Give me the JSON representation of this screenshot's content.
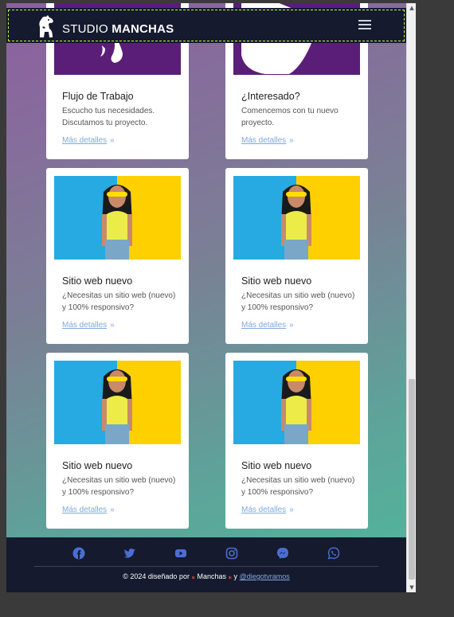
{
  "header": {
    "brand_light": "STUDIO",
    "brand_bold": "MANCHAS"
  },
  "cards": [
    {
      "title": "Flujo de Trabajo",
      "desc": "Escucho tus necesidades. Discutamos tu proyecto.",
      "more": "Más detalles"
    },
    {
      "title": "¿Interesado?",
      "desc": "Comencemos con tu nuevo proyecto.",
      "more": "Más detalles"
    },
    {
      "title": "Sitio web nuevo",
      "desc": "¿Necesitas un sitio web (nuevo) y 100% responsivo?",
      "more": "Más detalles"
    },
    {
      "title": "Sitio web nuevo",
      "desc": "¿Necesitas un sitio web (nuevo) y 100% responsivo?",
      "more": "Más detalles"
    },
    {
      "title": "Sitio web nuevo",
      "desc": "¿Necesitas un sitio web (nuevo) y 100% responsivo?",
      "more": "Más detalles"
    },
    {
      "title": "Sitio web nuevo",
      "desc": "¿Necesitas un sitio web (nuevo) y 100% responsivo?",
      "more": "Más detalles"
    }
  ],
  "footer": {
    "social_icons": [
      "facebook-icon",
      "twitter-icon",
      "youtube-icon",
      "instagram-icon",
      "messenger-icon",
      "whatsapp-icon"
    ],
    "copyright_prefix": "© 2024 diseñado por",
    "copyright_brand": "Manchas",
    "copyright_and": "y",
    "copyright_handle": "@diegotvramos"
  },
  "colors": {
    "navbar": "#151a2e",
    "link": "#7fa9e0",
    "accent_purple": "#5a1e78",
    "paw": "#ff5a3c"
  }
}
